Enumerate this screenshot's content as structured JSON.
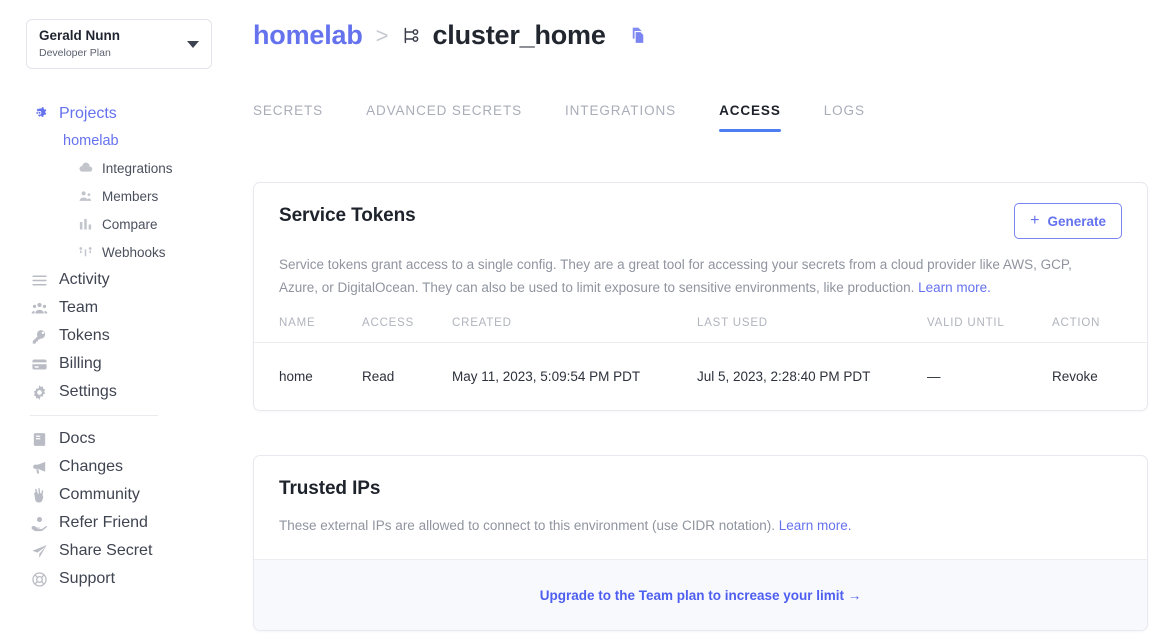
{
  "sidebar": {
    "account": {
      "name": "Gerald Nunn",
      "plan": "Developer Plan",
      "caret_icon": "chevron-down-icon"
    },
    "projects_label": "Projects",
    "projects_icon": "atom-gear-icon",
    "current_project": "homelab",
    "project_children": [
      {
        "label": "Integrations",
        "icon": "cloud-icon"
      },
      {
        "label": "Members",
        "icon": "people-icon"
      },
      {
        "label": "Compare",
        "icon": "bar-chart-icon"
      },
      {
        "label": "Webhooks",
        "icon": "webhook-icon"
      }
    ],
    "primary_items": [
      {
        "label": "Activity",
        "icon": "list-icon"
      },
      {
        "label": "Team",
        "icon": "team-icon"
      },
      {
        "label": "Tokens",
        "icon": "key-icon"
      },
      {
        "label": "Billing",
        "icon": "credit-card-icon"
      },
      {
        "label": "Settings",
        "icon": "gear-icon"
      }
    ],
    "secondary_items": [
      {
        "label": "Docs",
        "icon": "book-icon"
      },
      {
        "label": "Changes",
        "icon": "megaphone-icon"
      },
      {
        "label": "Community",
        "icon": "peace-hand-icon"
      },
      {
        "label": "Refer Friend",
        "icon": "hand-coin-icon"
      },
      {
        "label": "Share Secret",
        "icon": "paper-plane-icon"
      },
      {
        "label": "Support",
        "icon": "lifebuoy-icon"
      }
    ]
  },
  "header": {
    "project": "homelab",
    "separator": ">",
    "branch_icon": "branch-icon",
    "config": "cluster_home",
    "copy_icon": "copy-icon"
  },
  "tabs": [
    {
      "label": "SECRETS",
      "active": false
    },
    {
      "label": "ADVANCED SECRETS",
      "active": false
    },
    {
      "label": "INTEGRATIONS",
      "active": false
    },
    {
      "label": "ACCESS",
      "active": true
    },
    {
      "label": "LOGS",
      "active": false
    }
  ],
  "service_tokens": {
    "title": "Service Tokens",
    "generate_label": "Generate",
    "generate_plus": "+",
    "description": "Service tokens grant access to a single config. They are a great tool for accessing your secrets from a cloud provider like AWS, GCP, Azure, or DigitalOcean. They can also be used to limit exposure to sensitive environments, like production.",
    "learn_more": "Learn more.",
    "columns": [
      "NAME",
      "ACCESS",
      "CREATED",
      "LAST USED",
      "VALID UNTIL",
      "ACTION"
    ],
    "rows": [
      {
        "name": "home",
        "access": "Read",
        "created": "May 11, 2023, 5:09:54 PM PDT",
        "last_used": "Jul 5, 2023, 2:28:40 PM PDT",
        "valid_until": "—",
        "action": "Revoke"
      }
    ]
  },
  "trusted_ips": {
    "title": "Trusted IPs",
    "description": "These external IPs are allowed to connect to this environment (use CIDR notation).",
    "learn_more": "Learn more.",
    "upgrade_link": "Upgrade to the Team plan to increase your limit →"
  },
  "colors": {
    "accent": "#6572ee",
    "tab_underline": "#4d7df0",
    "danger": "#e05a5a",
    "muted": "#8f949f"
  }
}
